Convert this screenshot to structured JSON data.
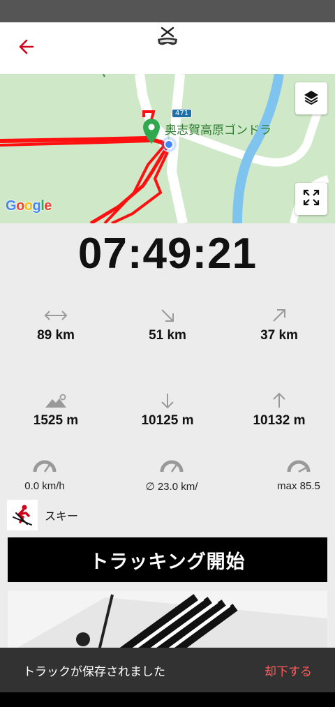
{
  "app": {
    "back_icon": "back-arrow-icon",
    "logo_icon": "skier-goggles-logo-icon",
    "accent_color": "#d0021b"
  },
  "map": {
    "place_label": "奥志賀高原ゴンドラ",
    "road_number": "471",
    "attribution": "Google",
    "layers_icon": "layers-icon",
    "fullscreen_icon": "fullscreen-icon"
  },
  "timer": {
    "value": "07:49:21"
  },
  "stats": {
    "row1": [
      {
        "icon": "distance-icon",
        "value": "89 km"
      },
      {
        "icon": "descent-distance-icon",
        "value": "51 km"
      },
      {
        "icon": "ascent-distance-icon",
        "value": "37 km"
      }
    ],
    "row2": [
      {
        "icon": "altitude-icon",
        "value": "1525 m"
      },
      {
        "icon": "descent-icon",
        "value": "10125 m"
      },
      {
        "icon": "ascent-icon",
        "value": "10132 m"
      }
    ],
    "row3": [
      {
        "icon": "speed-gauge-icon",
        "value": "0.0 km/h"
      },
      {
        "icon": "avg-speed-gauge-icon",
        "value": "∅ 23.0 km/"
      },
      {
        "icon": "max-speed-gauge-icon",
        "value": "max 85.5"
      }
    ]
  },
  "activity": {
    "icon": "ski-icon",
    "label": "スキー"
  },
  "start_button": {
    "label": "トラッキング開始"
  },
  "snackbar": {
    "message": "トラックが保存されました",
    "action": "却下する"
  }
}
